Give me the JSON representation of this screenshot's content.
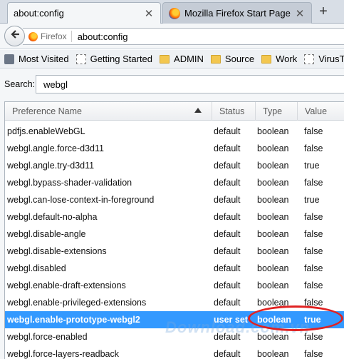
{
  "tabs": [
    {
      "title": "about:config",
      "active": true
    },
    {
      "title": "Mozilla Firefox Start Page",
      "active": false
    }
  ],
  "new_tab_label": "+",
  "close_glyph": "✕",
  "navbar": {
    "identity_label": "Firefox",
    "url": "about:config"
  },
  "bookmarks": [
    {
      "label": "Most Visited",
      "icon": "star-folder-icon"
    },
    {
      "label": "Getting Started",
      "icon": "page-icon"
    },
    {
      "label": "ADMIN",
      "icon": "folder-icon"
    },
    {
      "label": "Source",
      "icon": "folder-icon"
    },
    {
      "label": "Work",
      "icon": "folder-icon"
    },
    {
      "label": "VirusTotal - Fr",
      "icon": "page-icon"
    }
  ],
  "search": {
    "label": "Search:",
    "value": "webgl"
  },
  "columns": {
    "name": "Preference Name",
    "status": "Status",
    "type": "Type",
    "value": "Value"
  },
  "rows": [
    {
      "name": "pdfjs.enableWebGL",
      "status": "default",
      "type": "boolean",
      "value": "false"
    },
    {
      "name": "webgl.angle.force-d3d11",
      "status": "default",
      "type": "boolean",
      "value": "false"
    },
    {
      "name": "webgl.angle.try-d3d11",
      "status": "default",
      "type": "boolean",
      "value": "true"
    },
    {
      "name": "webgl.bypass-shader-validation",
      "status": "default",
      "type": "boolean",
      "value": "false"
    },
    {
      "name": "webgl.can-lose-context-in-foreground",
      "status": "default",
      "type": "boolean",
      "value": "true"
    },
    {
      "name": "webgl.default-no-alpha",
      "status": "default",
      "type": "boolean",
      "value": "false"
    },
    {
      "name": "webgl.disable-angle",
      "status": "default",
      "type": "boolean",
      "value": "false"
    },
    {
      "name": "webgl.disable-extensions",
      "status": "default",
      "type": "boolean",
      "value": "false"
    },
    {
      "name": "webgl.disabled",
      "status": "default",
      "type": "boolean",
      "value": "false"
    },
    {
      "name": "webgl.enable-draft-extensions",
      "status": "default",
      "type": "boolean",
      "value": "false"
    },
    {
      "name": "webgl.enable-privileged-extensions",
      "status": "default",
      "type": "boolean",
      "value": "false"
    },
    {
      "name": "webgl.enable-prototype-webgl2",
      "status": "user set",
      "type": "boolean",
      "value": "true",
      "selected": true
    },
    {
      "name": "webgl.force-enabled",
      "status": "default",
      "type": "boolean",
      "value": "false"
    },
    {
      "name": "webgl.force-layers-readback",
      "status": "default",
      "type": "boolean",
      "value": "false"
    }
  ],
  "watermark": "Download.com.vn",
  "colors": {
    "selection": "#3399ff",
    "highlight_ellipse": "#e02222"
  }
}
